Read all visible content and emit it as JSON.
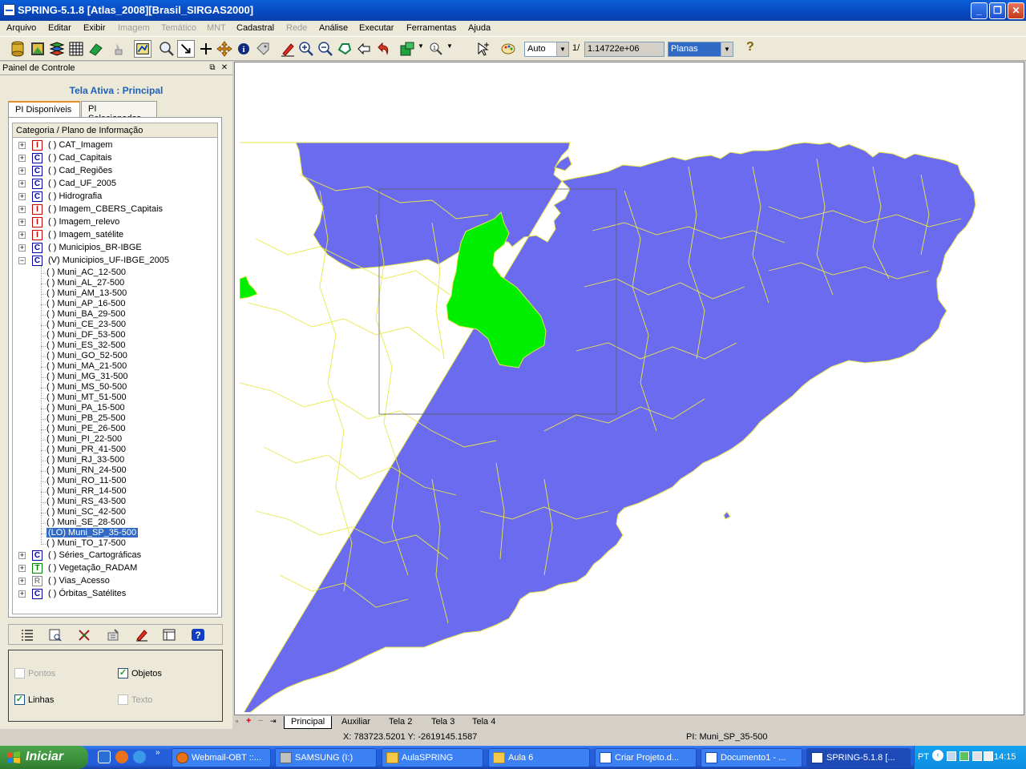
{
  "window": {
    "title": "SPRING-5.1.8 [Atlas_2008][Brasil_SIRGAS2000]",
    "buttons": [
      "_",
      "❐",
      "✕"
    ]
  },
  "menubar": [
    {
      "label": "Arquivo",
      "enabled": true
    },
    {
      "label": "Editar",
      "enabled": true
    },
    {
      "label": "Exibir",
      "enabled": true
    },
    {
      "label": "Imagem",
      "enabled": false
    },
    {
      "label": "Temático",
      "enabled": false
    },
    {
      "label": "MNT",
      "enabled": false
    },
    {
      "label": "Cadastral",
      "enabled": true
    },
    {
      "label": "Rede",
      "enabled": false
    },
    {
      "label": "Análise",
      "enabled": true
    },
    {
      "label": "Executar",
      "enabled": true
    },
    {
      "label": "Ferramentas",
      "enabled": true
    },
    {
      "label": "Ajuda",
      "enabled": true
    }
  ],
  "toolbar": {
    "zoom_mode": "Auto",
    "scale_prefix": "1/",
    "scale_value": "1.14722e+06",
    "projection": "Planas",
    "help": "?"
  },
  "control_panel": {
    "title": "Painel de Controle",
    "active_screen": "Tela Ativa : Principal",
    "tabs": [
      "PI Disponíveis",
      "PI Selecionados"
    ],
    "tree_header": "Categoria / Plano de Informação",
    "categories_top": [
      {
        "type": "I",
        "label": "( ) CAT_Imagem"
      },
      {
        "type": "C",
        "label": "( ) Cad_Capitais"
      },
      {
        "type": "C",
        "label": "( ) Cad_Regiões"
      },
      {
        "type": "C",
        "label": "( ) Cad_UF_2005"
      },
      {
        "type": "C",
        "label": "( ) Hidrografia"
      },
      {
        "type": "I",
        "label": "( ) Imagem_CBERS_Capitais"
      },
      {
        "type": "I",
        "label": "( ) Imagem_relevo"
      },
      {
        "type": "I",
        "label": "( ) Imagem_satélite"
      },
      {
        "type": "C",
        "label": "( ) Municipios_BR-IBGE"
      },
      {
        "type": "C",
        "label": "(V) Municipios_UF-IBGE_2005"
      }
    ],
    "children": [
      "( ) Muni_AC_12-500",
      "( ) Muni_AL_27-500",
      "( ) Muni_AM_13-500",
      "( ) Muni_AP_16-500",
      "( ) Muni_BA_29-500",
      "( ) Muni_CE_23-500",
      "( ) Muni_DF_53-500",
      "( ) Muni_ES_32-500",
      "( ) Muni_GO_52-500",
      "( ) Muni_MA_21-500",
      "( ) Muni_MG_31-500",
      "( ) Muni_MS_50-500",
      "( ) Muni_MT_51-500",
      "( ) Muni_PA_15-500",
      "( ) Muni_PB_25-500",
      "( ) Muni_PE_26-500",
      "( ) Muni_PI_22-500",
      "( ) Muni_PR_41-500",
      "( ) Muni_RJ_33-500",
      "( ) Muni_RN_24-500",
      "( ) Muni_RO_11-500",
      "( ) Muni_RR_14-500",
      "( ) Muni_RS_43-500",
      "( ) Muni_SC_42-500",
      "( ) Muni_SE_28-500",
      "(LO) Muni_SP_35-500",
      "( ) Muni_TO_17-500"
    ],
    "selected_child": "(LO) Muni_SP_35-500",
    "categories_bottom": [
      {
        "type": "C",
        "label": "( ) Séries_Cartográficas"
      },
      {
        "type": "T",
        "label": "( ) Vegetação_RADAM"
      },
      {
        "type": "R",
        "label": "( ) Vias_Acesso"
      },
      {
        "type": "C",
        "label": "( ) Órbitas_Satélites"
      }
    ],
    "options": {
      "pontos": {
        "label": "Pontos",
        "checked": false,
        "enabled": false
      },
      "objetos": {
        "label": "Objetos",
        "checked": true,
        "enabled": true
      },
      "linhas": {
        "label": "Linhas",
        "checked": true,
        "enabled": true
      },
      "texto": {
        "label": "Texto",
        "checked": false,
        "enabled": false
      }
    }
  },
  "map": {
    "fill_color": "#6b6bf0",
    "border_color": "#e8e84a",
    "highlight_color": "#00ee00"
  },
  "map_tabs": [
    "Principal",
    "Auxiliar",
    "Tela 2",
    "Tela 3",
    "Tela 4"
  ],
  "status": {
    "coords": "X: 783723.5201   Y: -2619145.1587",
    "pi": "PI: Muni_SP_35-500"
  },
  "taskbar": {
    "start": "Iniciar",
    "tasks": [
      "Webmail-OBT ::...",
      "SAMSUNG (I:)",
      "AulaSPRING",
      "Aula 6",
      "Criar Projeto.d...",
      "Documento1 - ...",
      "SPRING-5.1.8 [..."
    ],
    "language": "PT",
    "time": "14:15"
  }
}
